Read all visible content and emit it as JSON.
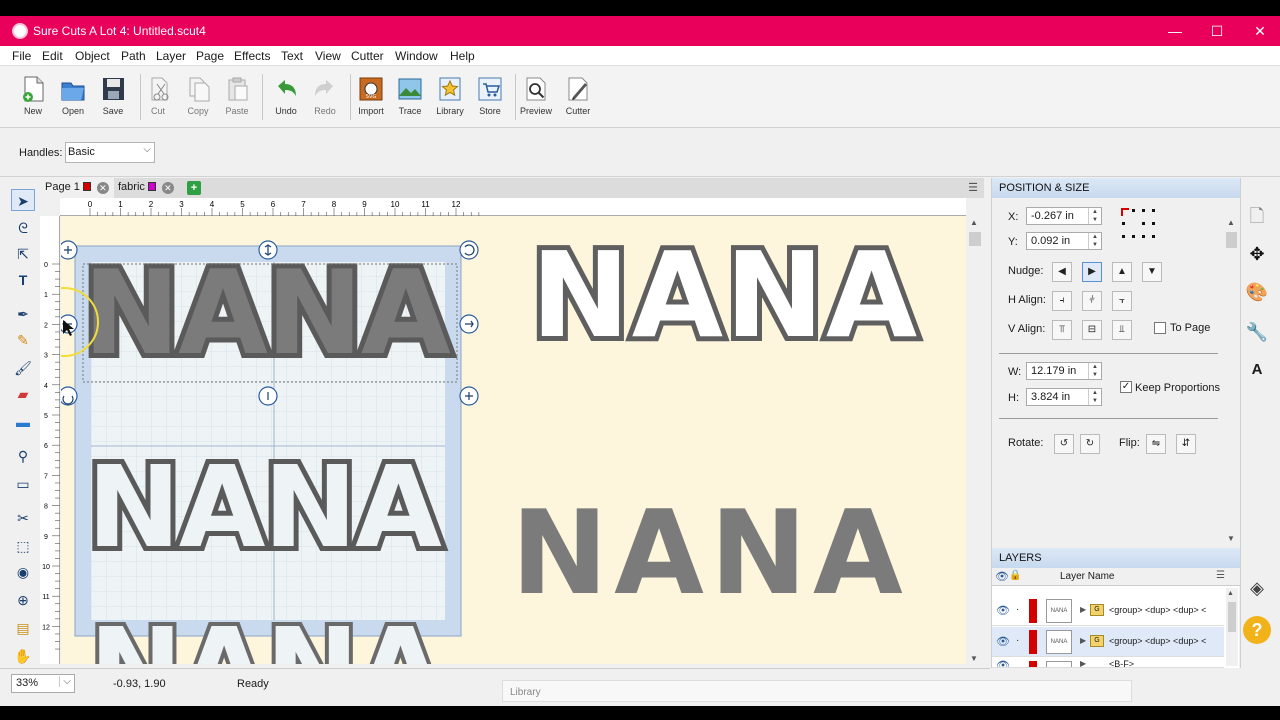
{
  "window": {
    "title": "Sure Cuts A Lot 4: Untitled.scut4",
    "minimize": "—",
    "maximize": "☐",
    "close": "✕"
  },
  "menu": [
    "File",
    "Edit",
    "Object",
    "Path",
    "Layer",
    "Page",
    "Effects",
    "Text",
    "View",
    "Cutter",
    "Window",
    "Help"
  ],
  "toolbar": {
    "new": "New",
    "open": "Open",
    "save": "Save",
    "cut": "Cut",
    "copy": "Copy",
    "paste": "Paste",
    "undo": "Undo",
    "redo": "Redo",
    "import": "Import",
    "trace": "Trace",
    "library": "Library",
    "store": "Store",
    "preview": "Preview",
    "cutter": "Cutter"
  },
  "handles": {
    "label": "Handles:",
    "value": "Basic"
  },
  "tabs": [
    {
      "label": "Page 1",
      "color": "#d40000"
    },
    {
      "label": "fabric",
      "color": "#d000d0"
    }
  ],
  "ruler": {
    "h": [
      "0",
      "1",
      "2",
      "3",
      "4",
      "5",
      "6",
      "7",
      "8",
      "9",
      "10",
      "11",
      "12"
    ],
    "v": [
      "0",
      "1",
      "2",
      "3",
      "4",
      "5",
      "6",
      "7",
      "8",
      "9",
      "10",
      "11",
      "12"
    ]
  },
  "canvas": {
    "word": "NANA",
    "fill_color": "#7b7b7b",
    "outline_color": "#5a5a5a",
    "mat_color": "#c9daee",
    "background": "#fdf6dc"
  },
  "status": {
    "zoom": "33%",
    "coords": "-0.93, 1.90",
    "state": "Ready",
    "library": "Library"
  },
  "position_size": {
    "header": "POSITION & SIZE",
    "x_label": "X:",
    "x_value": "-0.267 in",
    "y_label": "Y:",
    "y_value": "0.092 in",
    "nudge_label": "Nudge:",
    "halign_label": "H Align:",
    "valign_label": "V Align:",
    "to_page": "To Page",
    "w_label": "W:",
    "w_value": "12.179 in",
    "h_label": "H:",
    "h_value": "3.824 in",
    "keep_proportions": "Keep Proportions",
    "rotate_label": "Rotate:",
    "flip_label": "Flip:"
  },
  "layers": {
    "header": "LAYERS",
    "column": "Layer Name",
    "rows": [
      {
        "thumb": "NANA",
        "name": "<group> <dup> <dup> <",
        "icon": "G"
      },
      {
        "thumb": "NANA",
        "name": "<group> <dup> <dup> <",
        "icon": "G"
      },
      {
        "thumb": "····",
        "name": "<B-F>",
        "icon": ""
      }
    ]
  }
}
